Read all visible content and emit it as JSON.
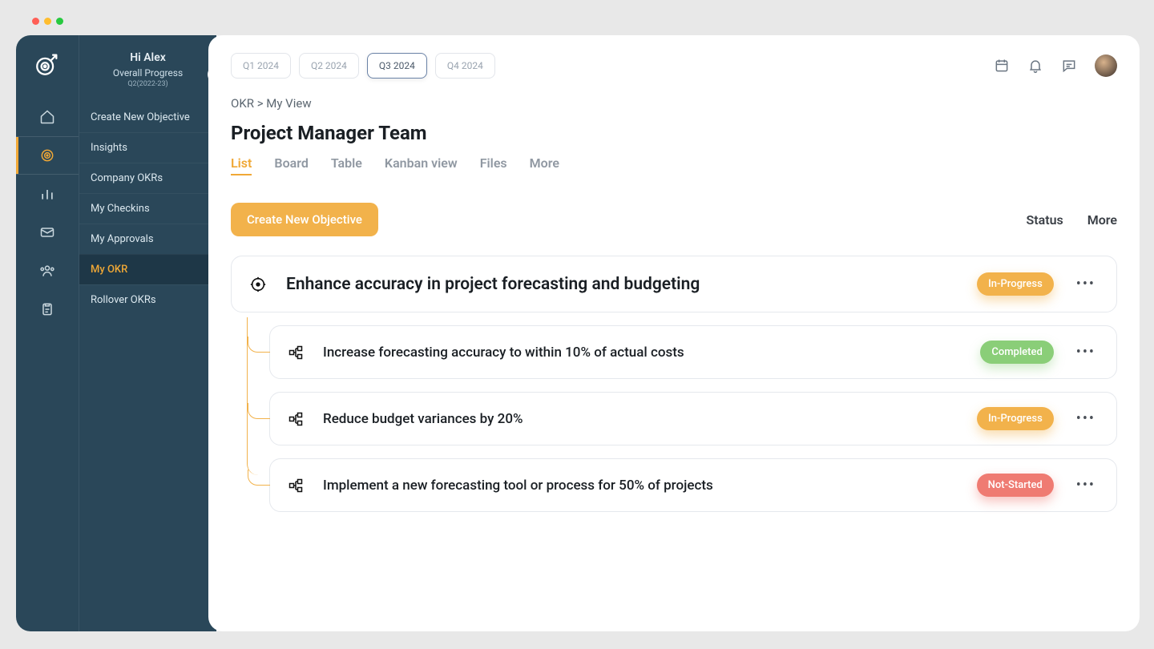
{
  "rail": {
    "items": [
      "home",
      "target",
      "chart",
      "mail",
      "people",
      "clipboard"
    ],
    "active_index": 1
  },
  "sidebar": {
    "greeting": "Hi Alex",
    "subtitle": "Overall Progress",
    "period": "Q2(2022-23)",
    "nav": [
      {
        "label": "Create New Objective"
      },
      {
        "label": "Insights"
      },
      {
        "label": "Company OKRs"
      },
      {
        "label": "My  Checkins"
      },
      {
        "label": "My Approvals"
      },
      {
        "label": "My OKR"
      },
      {
        "label": "Rollover OKRs"
      }
    ],
    "active_index": 5
  },
  "quarters": {
    "items": [
      "Q1 2024",
      "Q2 2024",
      "Q3 2024",
      "Q4 2024"
    ],
    "active_index": 2
  },
  "breadcrumb": "OKR > My View",
  "page_title": "Project Manager Team",
  "view_tabs": {
    "items": [
      "List",
      "Board",
      "Table",
      "Kanban view",
      "Files",
      "More"
    ],
    "active_index": 0
  },
  "toolbar": {
    "create_label": "Create New Objective",
    "right": [
      "Status",
      "More"
    ]
  },
  "objective": {
    "title": "Enhance accuracy in project forecasting and budgeting",
    "status": "In-Progress",
    "status_class": "in-progress",
    "key_results": [
      {
        "title": "Increase forecasting accuracy to within 10% of actual costs",
        "status": "Completed",
        "status_class": "completed"
      },
      {
        "title": "Reduce budget variances by 20%",
        "status": "In-Progress",
        "status_class": "in-progress"
      },
      {
        "title": "Implement a new forecasting tool or process for 50% of projects",
        "status": "Not-Started",
        "status_class": "not-started"
      }
    ]
  }
}
